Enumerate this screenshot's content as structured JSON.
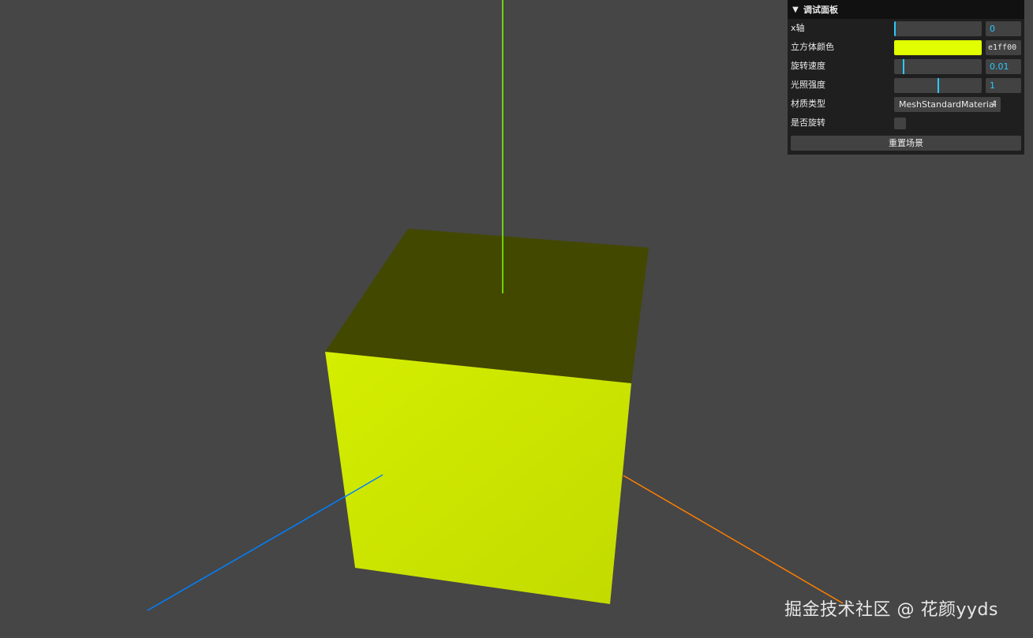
{
  "gui": {
    "title": "调试面板",
    "controls": {
      "x_axis": {
        "label": "x轴",
        "value": "0",
        "fraction": 0.0
      },
      "cube_color": {
        "label": "立方体颜色",
        "value": "e1ff00",
        "color": "#e1ff00"
      },
      "rotation_speed": {
        "label": "旋转速度",
        "value": "0.01",
        "fraction": 0.1
      },
      "light_intensity": {
        "label": "光照强度",
        "value": "1",
        "fraction": 0.5
      },
      "material_type": {
        "label": "材质类型",
        "value": "MeshStandardMaterial"
      },
      "is_rotating": {
        "label": "是否旋转",
        "checked": false
      }
    },
    "reset_button": "重置场景"
  },
  "scene": {
    "background": "#464646",
    "cube_face_top": "#434800",
    "cube_face_front": "#c9e200",
    "cube_face_right": "#3b3f00",
    "axis_colors": {
      "x": "#ff7f00",
      "y": "#7fff00",
      "z": "#0080ff"
    }
  },
  "watermark": "掘金技术社区 @ 花颜yyds"
}
